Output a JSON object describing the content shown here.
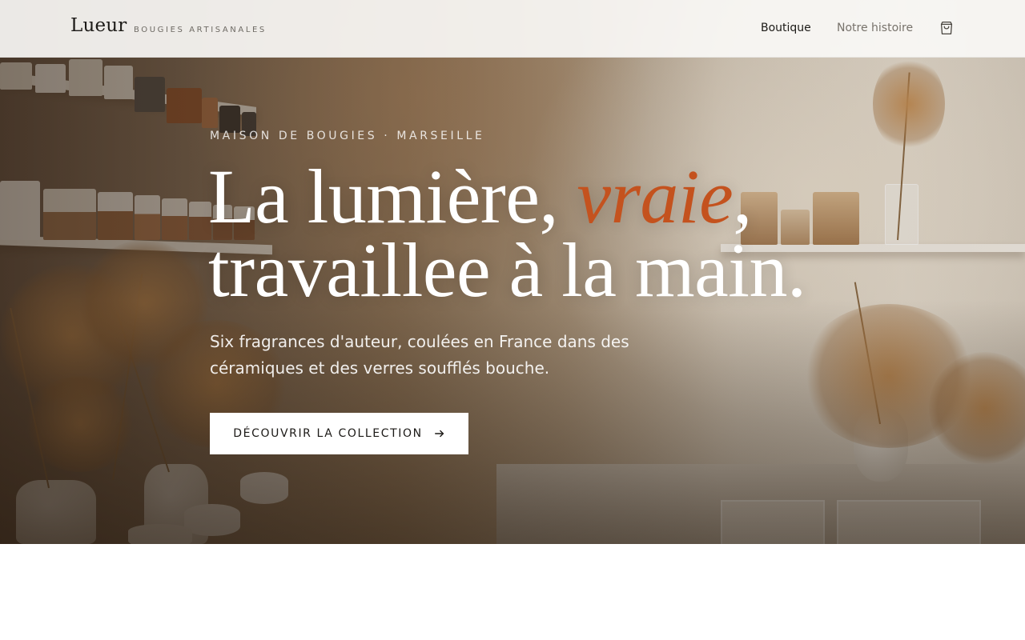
{
  "header": {
    "brand": "Lueur",
    "tagline": "BOUGIES ARTISANALES",
    "nav": [
      {
        "label": "Boutique",
        "active": true
      },
      {
        "label": "Notre histoire",
        "active": false
      }
    ],
    "cart_icon": "shopping-bag-icon"
  },
  "hero": {
    "eyebrow": "MAISON DE BOUGIES · MARSEILLE",
    "headline_part1": "La lumière, ",
    "headline_accent": "vraie",
    "headline_part2": ",",
    "headline_line2": "travaillee à la main.",
    "subtitle": "Six fragrances d'auteur, coulées en France dans des céramiques et des verres soufflés bouche.",
    "cta_label": "DÉCOUVRIR LA COLLECTION",
    "cta_icon": "arrow-right-icon"
  },
  "colors": {
    "accent": "#c4521e",
    "text_dark": "#1c1a17",
    "header_bg": "#faf8f6",
    "nav_muted": "#77726b"
  }
}
